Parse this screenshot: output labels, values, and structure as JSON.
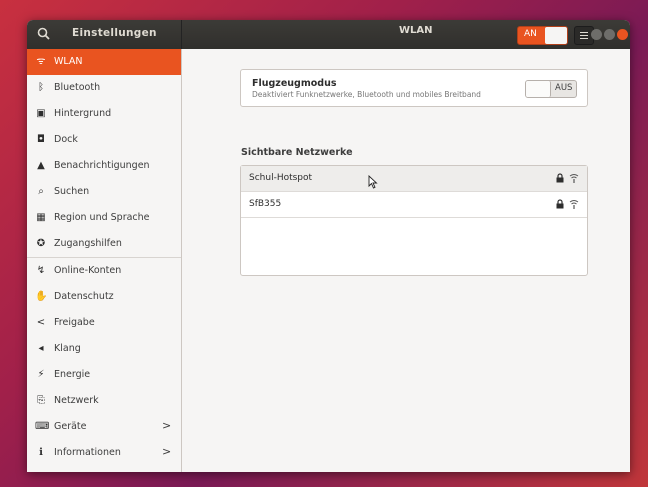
{
  "header": {
    "app_title": "Einstellungen",
    "page_title": "WLAN",
    "wifi_toggle_label": "AN"
  },
  "sidebar": {
    "items": [
      {
        "label": "WLAN",
        "icon": "wifi-icon"
      },
      {
        "label": "Bluetooth",
        "icon": "bluetooth-icon"
      },
      {
        "label": "Hintergrund",
        "icon": "background-icon"
      },
      {
        "label": "Dock",
        "icon": "dock-icon"
      },
      {
        "label": "Benachrichtigungen",
        "icon": "bell-icon"
      },
      {
        "label": "Suchen",
        "icon": "search-icon"
      },
      {
        "label": "Region und Sprache",
        "icon": "keyboard-icon"
      },
      {
        "label": "Zugangshilfen",
        "icon": "accessibility-icon"
      },
      {
        "label": "Online-Konten",
        "icon": "online-accounts-icon"
      },
      {
        "label": "Datenschutz",
        "icon": "hand-icon"
      },
      {
        "label": "Freigabe",
        "icon": "share-icon"
      },
      {
        "label": "Klang",
        "icon": "speaker-icon"
      },
      {
        "label": "Energie",
        "icon": "battery-icon"
      },
      {
        "label": "Netzwerk",
        "icon": "network-icon"
      },
      {
        "label": "Geräte",
        "icon": "devices-icon"
      },
      {
        "label": "Informationen",
        "icon": "info-icon"
      }
    ]
  },
  "airplane": {
    "title": "Flugzeugmodus",
    "subtitle": "Deaktiviert Funknetzwerke, Bluetooth und mobiles Breitband",
    "toggle_label": "AUS"
  },
  "networks": {
    "section_title": "Sichtbare Netzwerke",
    "items": [
      {
        "name": "Schul-Hotspot"
      },
      {
        "name": "SfB355"
      }
    ]
  },
  "colors": {
    "accent": "#e95420",
    "headerbar": "#3c3b37"
  }
}
